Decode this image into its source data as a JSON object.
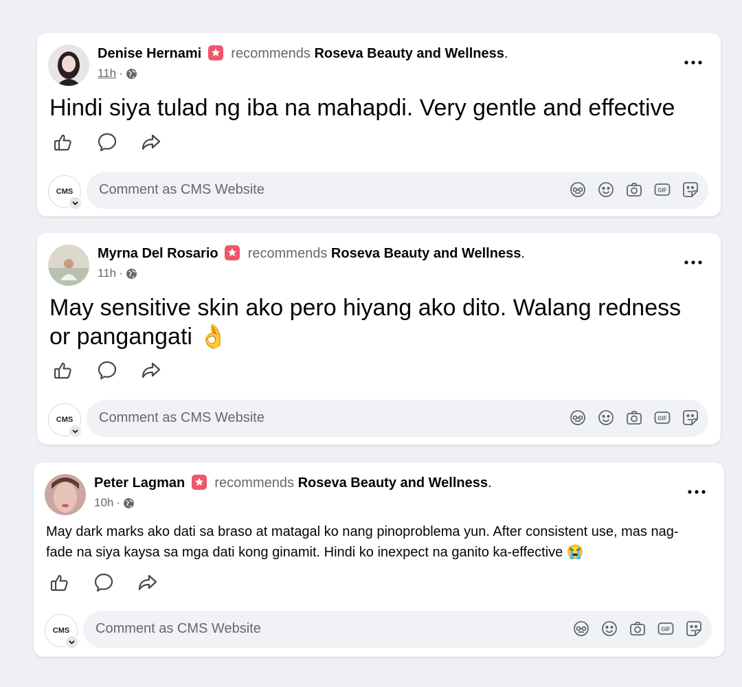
{
  "posts": [
    {
      "author": "Denise Hernami",
      "recommends_text": "recommends",
      "page": "Roseva Beauty and Wellness",
      "page_suffix": ".",
      "time": "11h",
      "separator": "·",
      "text": "Hindi siya tulad ng iba na mahapdi. Very gentle and effective",
      "comment_placeholder": "Comment as CMS Website",
      "commenter_avatar_text": "CMS"
    },
    {
      "author": "Myrna Del Rosario",
      "recommends_text": "recommends",
      "page": "Roseva Beauty and Wellness",
      "page_suffix": ".",
      "time": "11h",
      "separator": "·",
      "text": "May sensitive skin ako pero hiyang ako dito. Walang redness or pangangati 👌",
      "comment_placeholder": "Comment as CMS Website",
      "commenter_avatar_text": "CMS"
    },
    {
      "author": "Peter Lagman",
      "recommends_text": "recommends",
      "page": "Roseva Beauty and Wellness",
      "page_suffix": ".",
      "time": "10h",
      "separator": "·",
      "text": "May dark marks ako dati sa braso at matagal ko nang pinoproblema yun. After consistent use, mas nag-fade na siya kaysa sa mga dati kong ginamit. Hindi ko inexpect na ganito ka-effective 😭",
      "comment_placeholder": "Comment as CMS Website",
      "commenter_avatar_text": "CMS"
    }
  ],
  "icons": {
    "recommend_badge": "star-badge-icon",
    "audience": "globe-icon",
    "more": "more-options-icon",
    "like": "like-icon",
    "comment": "comment-icon",
    "share": "share-icon",
    "comment_tools": [
      "avatar-sticker-icon",
      "emoji-icon",
      "camera-icon",
      "gif-icon",
      "sticker-icon"
    ]
  },
  "colors": {
    "page_background": "#eef0f5",
    "recommend_badge": "#f0566b",
    "secondary_text": "#65676b",
    "comment_box": "#f0f2f5"
  }
}
